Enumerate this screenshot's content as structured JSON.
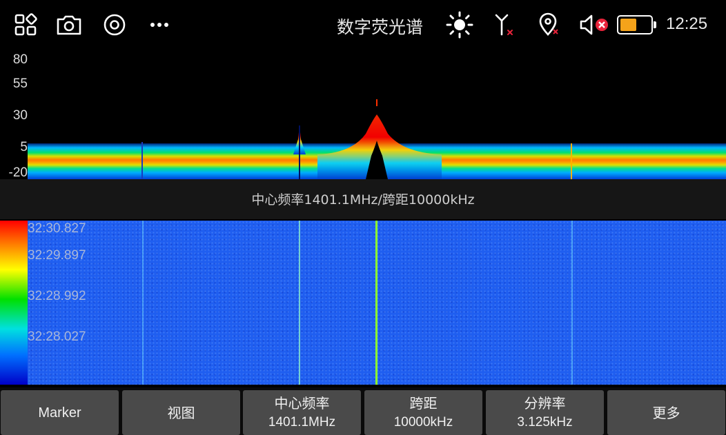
{
  "status_bar": {
    "title": "数字荧光谱",
    "time": "12:25",
    "battery_level": 0.55,
    "colors": {
      "battery_fill": "#f5a31a",
      "alert": "#e8233a"
    },
    "icons": [
      "apps-grid-icon",
      "camera-icon",
      "record-target-icon",
      "more-dots-icon",
      "brightness-sun-icon",
      "antenna-off-icon",
      "location-off-icon",
      "speaker-muted-icon",
      "battery-icon"
    ]
  },
  "spectrum": {
    "y_ticks": [
      "80",
      "55",
      "30",
      "5",
      "-20"
    ],
    "caption": "中心频率1401.1MHz/跨距10000kHz"
  },
  "waterfall": {
    "timestamps": [
      "32:30.827",
      "32:29.897",
      "32:28.992",
      "32:28.027"
    ]
  },
  "toolbar": {
    "buttons": [
      {
        "label": "Marker",
        "value": ""
      },
      {
        "label": "视图",
        "value": ""
      },
      {
        "label": "中心频率",
        "value": "1401.1MHz"
      },
      {
        "label": "跨距",
        "value": "10000kHz"
      },
      {
        "label": "分辨率",
        "value": "3.125kHz"
      },
      {
        "label": "更多",
        "value": ""
      }
    ]
  }
}
